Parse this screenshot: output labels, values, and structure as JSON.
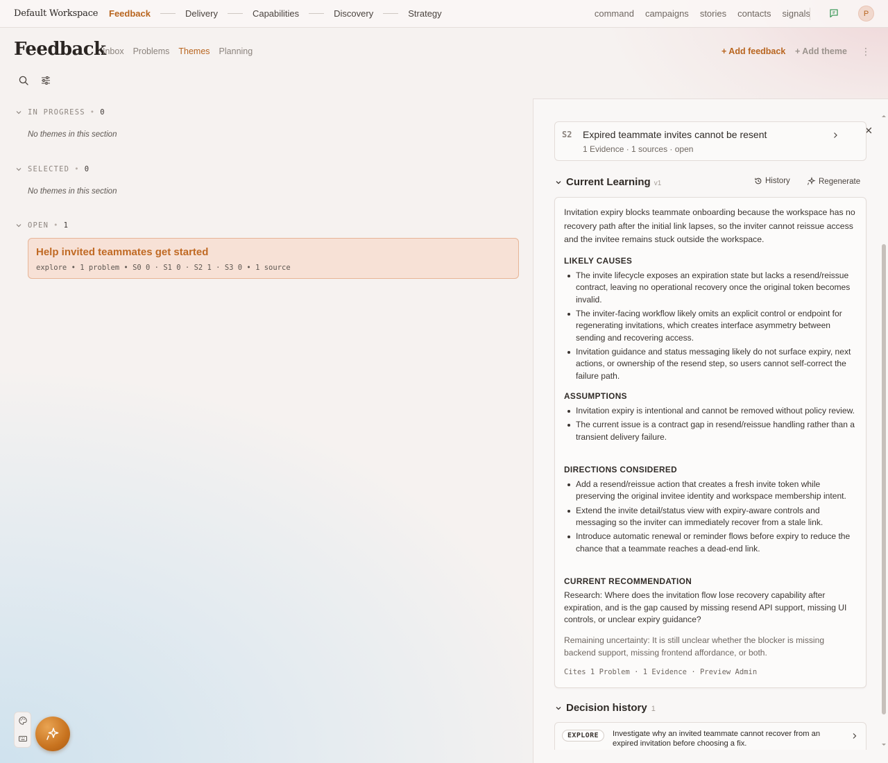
{
  "topbar": {
    "workspace": "Default Workspace",
    "nav": [
      "Feedback",
      "Delivery",
      "Capabilities",
      "Discovery",
      "Strategy"
    ],
    "right_links": [
      "command",
      "campaigns",
      "stories",
      "contacts",
      "signals"
    ],
    "avatar_initial": "P"
  },
  "header": {
    "title": "Feedback",
    "tabs": [
      "Inbox",
      "Problems",
      "Themes",
      "Planning"
    ],
    "active_tab": "Themes",
    "add_feedback": "+ Add feedback",
    "add_theme": "+ Add theme"
  },
  "sections": [
    {
      "label": "IN PROGRESS",
      "count": "0",
      "empty_text": "No themes in this section"
    },
    {
      "label": "SELECTED",
      "count": "0",
      "empty_text": "No themes in this section"
    },
    {
      "label": "OPEN",
      "count": "1"
    }
  ],
  "theme": {
    "title": "Help invited teammates get started",
    "meta": "explore • 1 problem • S0 0 · S1 0 · S2 1 · S3 0 • 1 source"
  },
  "problem": {
    "severity": "S2",
    "title": "Expired teammate invites cannot be resent",
    "meta": "1 Evidence · 1 sources · open"
  },
  "learning": {
    "title": "Current Learning",
    "version": "v1",
    "history_label": "History",
    "regenerate_label": "Regenerate",
    "intro": "Invitation expiry blocks teammate onboarding because the workspace has no recovery path after the initial link lapses, so the inviter cannot reissue access and the invitee remains stuck outside the workspace.",
    "likely_causes_heading": "LIKELY CAUSES",
    "likely_causes": [
      "The invite lifecycle exposes an expiration state but lacks a resend/reissue contract, leaving no operational recovery once the original token becomes invalid.",
      "The inviter-facing workflow likely omits an explicit control or endpoint for regenerating invitations, which creates interface asymmetry between sending and recovering access.",
      "Invitation guidance and status messaging likely do not surface expiry, next actions, or ownership of the resend step, so users cannot self-correct the failure path."
    ],
    "assumptions_heading": "ASSUMPTIONS",
    "assumptions": [
      "Invitation expiry is intentional and cannot be removed without policy review.",
      "The current issue is a contract gap in resend/reissue handling rather than a transient delivery failure."
    ],
    "directions_heading": "DIRECTIONS CONSIDERED",
    "directions": [
      "Add a resend/reissue action that creates a fresh invite token while preserving the original invitee identity and workspace membership intent.",
      "Extend the invite detail/status view with expiry-aware controls and messaging so the inviter can immediately recover from a stale link.",
      "Introduce automatic renewal or reminder flows before expiry to reduce the chance that a teammate reaches a dead-end link."
    ],
    "recommendation_heading": "CURRENT RECOMMENDATION",
    "recommendation": "Research: Where does the invitation flow lose recovery capability after expiration, and is the gap caused by missing resend API support, missing UI controls, or unclear expiry guidance?",
    "uncertainty": "Remaining uncertainty: It is still unclear whether the blocker is missing backend support, missing frontend affordance, or both.",
    "cites": "Cites 1 Problem · 1 Evidence · Preview Admin"
  },
  "decision_history": {
    "title": "Decision history",
    "count": "1",
    "items": [
      {
        "badge": "EXPLORE",
        "text": "Investigate why an invited teammate cannot recover from an expired invitation before choosing a fix."
      }
    ]
  },
  "colors": {
    "accent": "#b8651f",
    "card_bg": "#f7e1d6",
    "card_border": "#e7b496"
  }
}
